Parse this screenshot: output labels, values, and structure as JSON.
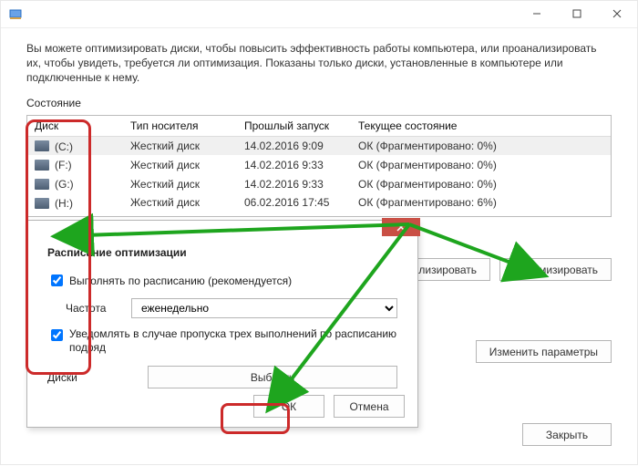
{
  "window": {
    "intro": "Вы можете оптимизировать диски, чтобы повысить эффективность работы компьютера, или проанализировать их, чтобы увидеть, требуется ли оптимизация. Показаны только диски, установленные в компьютере или подключенные к нему.",
    "state_label": "Состояние"
  },
  "table": {
    "headers": {
      "drive": "Диск",
      "media": "Тип носителя",
      "last": "Прошлый запуск",
      "status": "Текущее состояние"
    },
    "rows": [
      {
        "drive": "(C:)",
        "media": "Жесткий диск",
        "last": "14.02.2016 9:09",
        "status": "ОК (Фрагментировано: 0%)"
      },
      {
        "drive": "(F:)",
        "media": "Жесткий диск",
        "last": "14.02.2016 9:33",
        "status": "ОК (Фрагментировано: 0%)"
      },
      {
        "drive": "(G:)",
        "media": "Жесткий диск",
        "last": "14.02.2016 9:33",
        "status": "ОК (Фрагментировано: 0%)"
      },
      {
        "drive": "(H:)",
        "media": "Жесткий диск",
        "last": "06.02.2016 17:45",
        "status": "ОК (Фрагментировано: 6%)"
      }
    ]
  },
  "buttons": {
    "analyze": "Анализировать",
    "optimize": "Оптимизировать",
    "change_params": "Изменить параметры",
    "close": "Закрыть"
  },
  "modal": {
    "title": "Расписание оптимизации",
    "schedule_chk": "Выполнять по расписанию (рекомендуется)",
    "freq_label": "Частота",
    "freq_value": "еженедельно",
    "notify": "Уведомлять в случае пропуска трех выполнений по расписанию подряд",
    "disks_label": "Диски",
    "choose": "Выбрать",
    "ok": "ОК",
    "cancel": "Отмена"
  }
}
